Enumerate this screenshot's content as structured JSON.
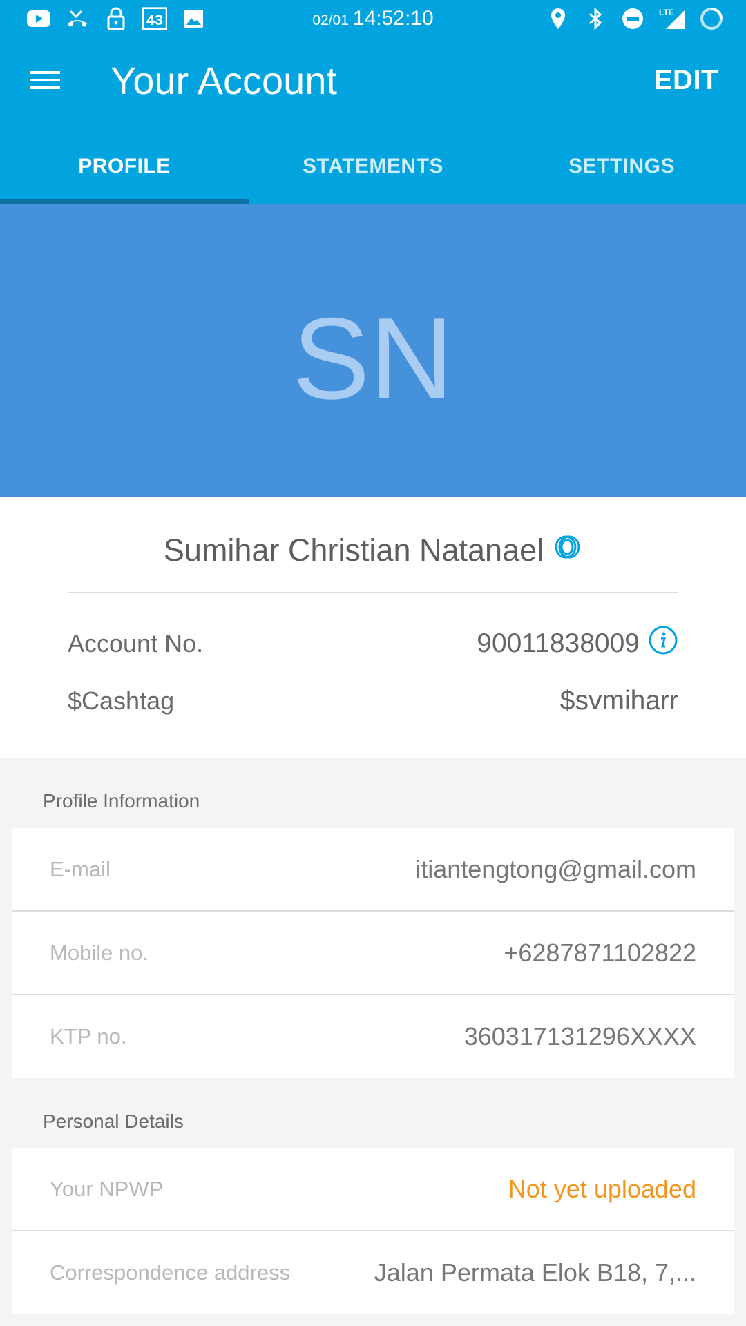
{
  "status_bar": {
    "date": "02/01",
    "time": "14:52:10",
    "left_icons": [
      "youtube-icon",
      "missed-call-icon",
      "lock-icon",
      "badge-43-icon",
      "image-icon"
    ],
    "badge_number": "43",
    "right_icons": [
      "location-icon",
      "bluetooth-icon",
      "do-not-disturb-icon",
      "lte-signal-icon",
      "loading-circle-icon"
    ],
    "lte_label": "LTE"
  },
  "app_bar": {
    "title": "Your Account",
    "edit_label": "EDIT"
  },
  "tabs": [
    {
      "label": "PROFILE",
      "active": true
    },
    {
      "label": "STATEMENTS",
      "active": false
    },
    {
      "label": "SETTINGS",
      "active": false
    }
  ],
  "avatar": {
    "initials": "SN"
  },
  "identity": {
    "name": "Sumihar Christian Natanael",
    "account_label": "Account No.",
    "account_value": "90011838009",
    "cashtag_label": "$Cashtag",
    "cashtag_value": "$svmiharr"
  },
  "profile_information": {
    "title": "Profile Information",
    "rows": [
      {
        "label": "E-mail",
        "value": "itiantengtong@gmail.com"
      },
      {
        "label": "Mobile no.",
        "value": "+6287871102822"
      },
      {
        "label": "KTP no.",
        "value": "360317131296XXXX"
      }
    ]
  },
  "personal_details": {
    "title": "Personal Details",
    "rows": [
      {
        "label": "Your NPWP",
        "value": "Not yet uploaded"
      },
      {
        "label": "Correspondence address",
        "value": "Jalan Permata Elok B18, 7,..."
      }
    ]
  },
  "colors": {
    "primary": "#02a4df",
    "banner": "#4691dc",
    "tab_indicator": "#0a73a3",
    "warning": "#f7941d"
  }
}
